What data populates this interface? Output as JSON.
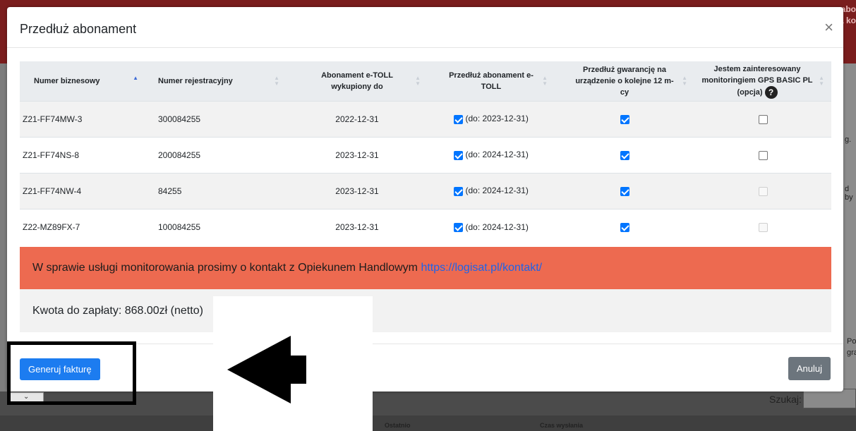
{
  "background": {
    "right_texts": [
      "abo",
      "a ko",
      "g.",
      "d by",
      "Poj",
      "gra"
    ],
    "search_label": "Szukaj:",
    "columns": [
      "Ostatnio",
      "Czas wysłania"
    ]
  },
  "modal": {
    "title": "Przedłuż abonament",
    "close_label": "×",
    "headers": [
      "Numer biznesowy",
      "Numer rejestracyjny",
      "Abonament e-TOLL wykupiony do",
      "Przedłuż abonament e-TOLL",
      "Przedłuż gwarancję na urządzenie o kolejne 12 m-cy",
      "Jestem zainteresowany monitoringiem GPS BASIC PL (opcja)"
    ],
    "help_icon_label": "?",
    "rows": [
      {
        "business": "Z21-FF74MW-3",
        "registration": "300084255",
        "until": "2022-12-31",
        "extend_label": "(do: 2023-12-31)"
      },
      {
        "business": "Z21-FF74NS-8",
        "registration": "200084255",
        "until": "2023-12-31",
        "extend_label": "(do: 2024-12-31)"
      },
      {
        "business": "Z21-FF74NW-4",
        "registration": "84255",
        "until": "2023-12-31",
        "extend_label": "(do: 2024-12-31)"
      },
      {
        "business": "Z22-MZ89FX-7",
        "registration": "100084255",
        "until": "2023-12-31",
        "extend_label": "(do: 2024-12-31)"
      }
    ],
    "alert_text": "W sprawie usługi monitorowania prosimy o kontakt z Opiekunem Handlowym",
    "alert_link": "https://logisat.pl/kontakt/",
    "amount_text": "Kwota do zapłaty: 868.00zł (netto)",
    "primary_button": "Generuj fakturę",
    "cancel_button": "Anuluj"
  }
}
